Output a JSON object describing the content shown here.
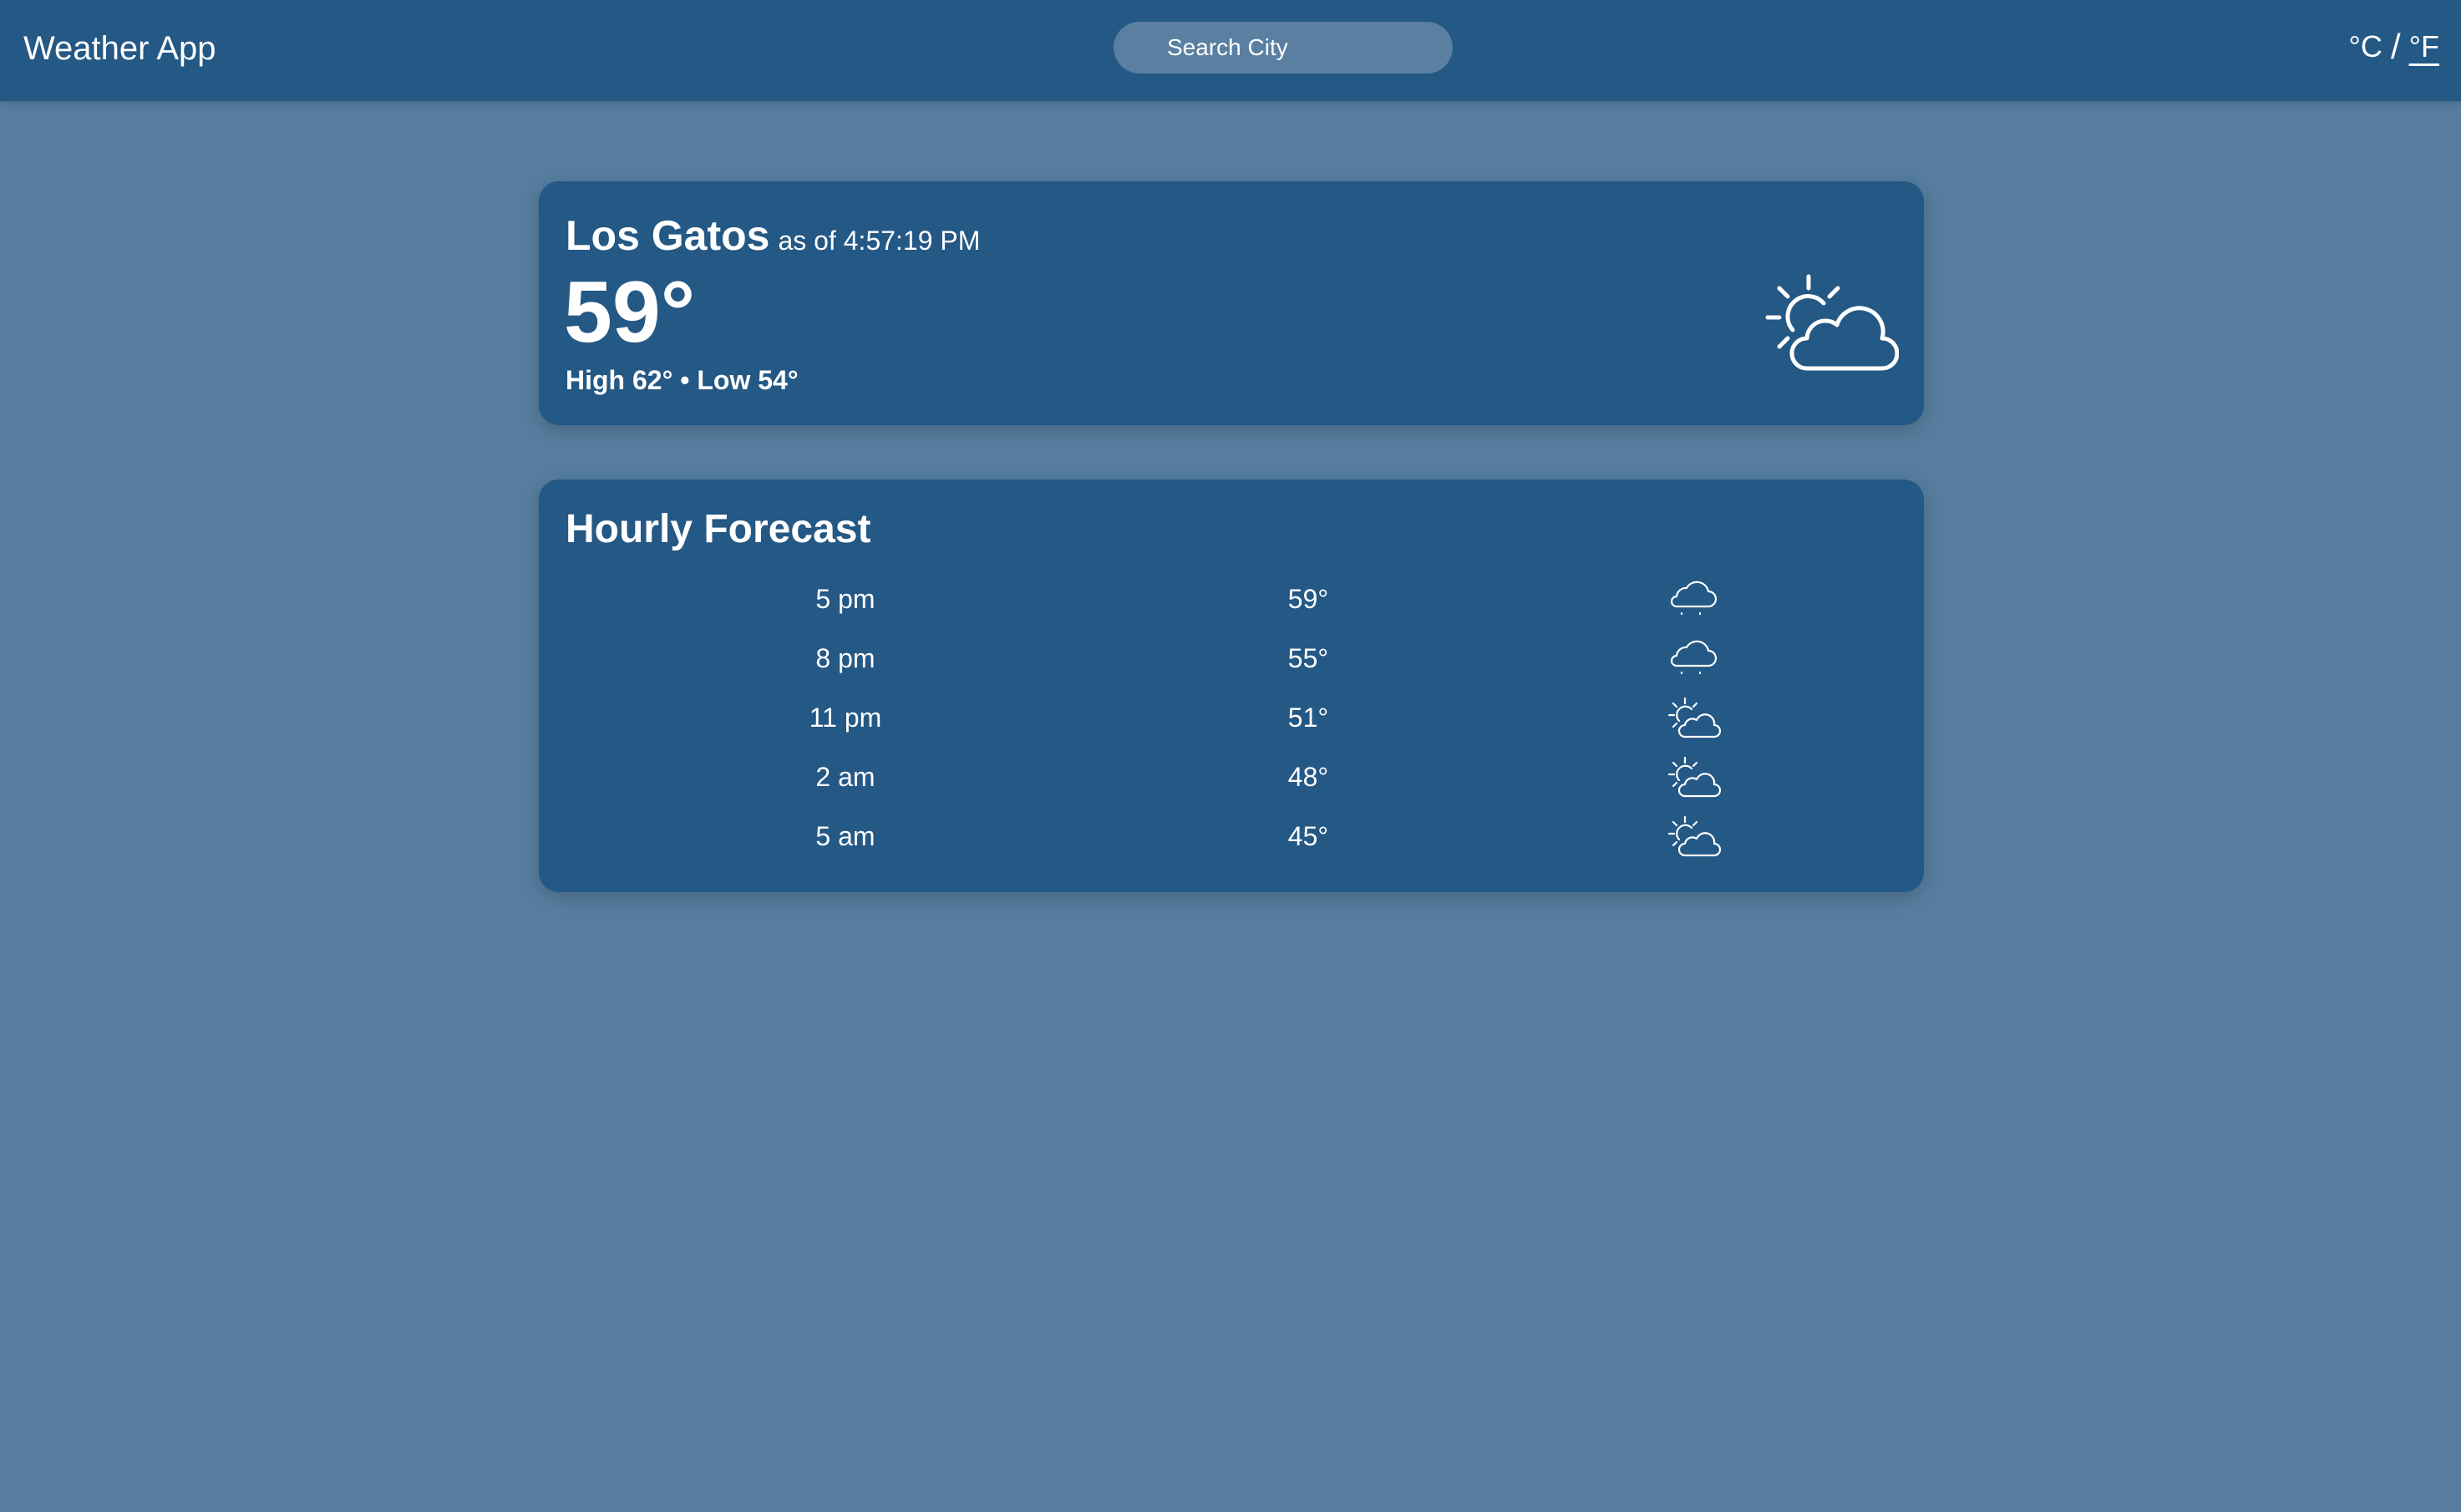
{
  "header": {
    "app_title": "Weather App",
    "search_placeholder": "Search City",
    "unit_celsius": "°C",
    "unit_separator": "/",
    "unit_fahrenheit": "°F",
    "active_unit": "°F"
  },
  "current": {
    "city": "Los Gatos",
    "as_of": "as of 4:57:19 PM",
    "temperature": "59°",
    "high_low": "High 62° • Low 54°",
    "condition_icon": "partly-cloudy-icon"
  },
  "hourly": {
    "title": "Hourly Forecast",
    "rows": [
      {
        "time": "5 pm",
        "temp": "59°",
        "icon": "cloud-drizzle-icon"
      },
      {
        "time": "8 pm",
        "temp": "55°",
        "icon": "cloud-drizzle-icon"
      },
      {
        "time": "11 pm",
        "temp": "51°",
        "icon": "partly-cloudy-icon"
      },
      {
        "time": "2 am",
        "temp": "48°",
        "icon": "partly-cloudy-icon"
      },
      {
        "time": "5 am",
        "temp": "45°",
        "icon": "partly-cloudy-icon"
      }
    ]
  },
  "colors": {
    "page_background": "#567d9e",
    "panel_background": "#245885",
    "search_background": "#5a7fa1",
    "text": "#ffffff"
  }
}
